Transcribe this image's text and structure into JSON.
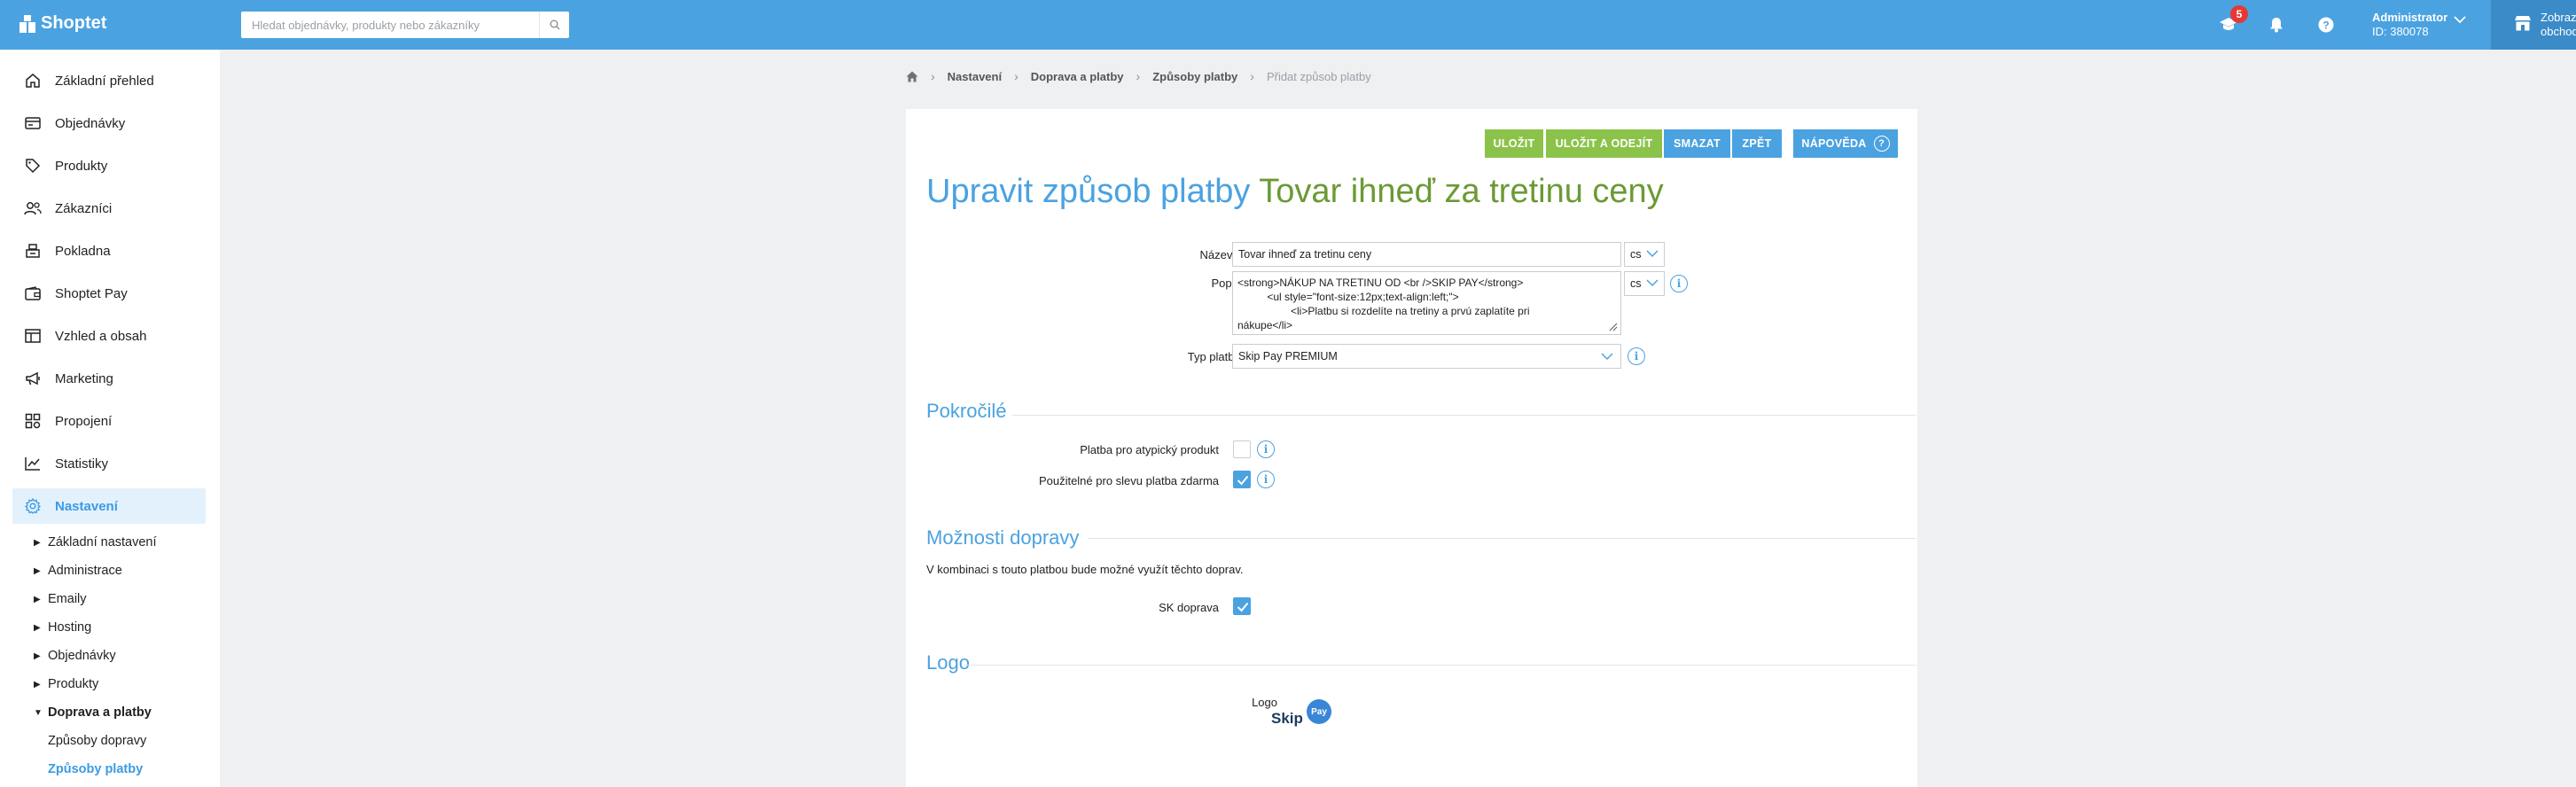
{
  "topbar": {
    "brand": "Shoptet",
    "search_placeholder": "Hledat objednávky, produkty nebo zákazníky",
    "notification_count": "5",
    "admin_name": "Administrator",
    "admin_id": "ID: 380078",
    "shop_button_line1": "Zobraz",
    "shop_button_line2": "obchod"
  },
  "sidebar": {
    "items": [
      {
        "label": "Základní přehled",
        "icon": "home-icon"
      },
      {
        "label": "Objednávky",
        "icon": "orders-icon"
      },
      {
        "label": "Produkty",
        "icon": "tag-icon"
      },
      {
        "label": "Zákazníci",
        "icon": "customers-icon"
      },
      {
        "label": "Pokladna",
        "icon": "cash-register-icon"
      },
      {
        "label": "Shoptet Pay",
        "icon": "wallet-icon"
      },
      {
        "label": "Vzhled a obsah",
        "icon": "layout-icon"
      },
      {
        "label": "Marketing",
        "icon": "megaphone-icon"
      },
      {
        "label": "Propojení",
        "icon": "integrations-icon"
      },
      {
        "label": "Statistiky",
        "icon": "chart-icon"
      },
      {
        "label": "Nastavení",
        "icon": "gear-icon"
      }
    ],
    "submenu": [
      {
        "label": "Základní nastavení"
      },
      {
        "label": "Administrace"
      },
      {
        "label": "Emaily"
      },
      {
        "label": "Hosting"
      },
      {
        "label": "Objednávky"
      },
      {
        "label": "Produkty"
      },
      {
        "label": "Doprava a platby"
      }
    ],
    "subsubmenu": [
      {
        "label": "Způsoby dopravy"
      },
      {
        "label": "Způsoby platby"
      }
    ]
  },
  "breadcrumb": [
    "Nastavení",
    "Doprava a platby",
    "Způsoby platby",
    "Přidat způsob platby"
  ],
  "toolbar": {
    "save": "ULOŽIT",
    "save_exit": "ULOŽIT A ODEJÍT",
    "delete": "SMAZAT",
    "back": "ZPĚT",
    "help": "NÁPOVĚDA"
  },
  "page": {
    "title_prefix": "Upravit způsob platby",
    "title_name": "Tovar ihneď za tretinu ceny"
  },
  "form": {
    "name_label": "Název *",
    "name_value": "Tovar ihneď za tretinu ceny",
    "name_lang": "cs",
    "description_label": "Popis",
    "description_value": "<strong>NÁKUP NA TRETINU OD <br />SKIP PAY</strong>\n          <ul style=\"font-size:12px;text-align:left;\">\n                  <li>Platbu si rozdelíte na tretiny a prvú zaplatíte pri\nnákupe</li>\n                  <li>Zvyšné dve tretiny zaplatíte postupne po mesiaci</li>",
    "description_lang": "cs",
    "payment_type_label": "Typ platby",
    "payment_type_value": "Skip Pay PREMIUM"
  },
  "advanced": {
    "heading": "Pokročilé",
    "atypical_label": "Platba pro atypický produkt",
    "atypical_checked": false,
    "free_shipping_label": "Použitelné pro slevu platba zdarma",
    "free_shipping_checked": true
  },
  "shipping": {
    "heading": "Možnosti dopravy",
    "note": "V kombinaci s touto platbou bude možné využít těchto doprav.",
    "option_label": "SK doprava",
    "option_checked": true
  },
  "logo": {
    "heading": "Logo",
    "label": "Logo",
    "logo_text": "Skip",
    "logo_badge": "Pay"
  },
  "colors": {
    "accent": "#4ba2e0",
    "green": "#8bc34a",
    "title_green": "#6b9a34"
  }
}
